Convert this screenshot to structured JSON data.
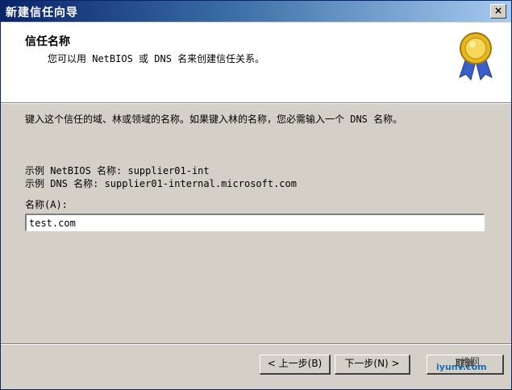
{
  "window": {
    "title": "新建信任向导",
    "close_label": "×"
  },
  "header": {
    "title": "信任名称",
    "subtitle": "您可以用 NetBIOS 或 DNS 名来创建信任关系。",
    "icon": "award-ribbon-icon"
  },
  "content": {
    "instruction": "键入这个信任的域、林或领域的名称。如果键入林的名称，您必需输入一个 DNS 名称。",
    "example_netbios": "示例 NetBIOS 名称: supplier01-int",
    "example_dns": "示例 DNS 名称: supplier01-internal.microsoft.com",
    "name_label": "名称(A):",
    "name_value": "test.com"
  },
  "buttons": {
    "back": "< 上一步(B)",
    "next": "下一步(N) >",
    "cancel": "取消"
  },
  "watermark": {
    "text": "iyunv.com",
    "site": "维网"
  }
}
